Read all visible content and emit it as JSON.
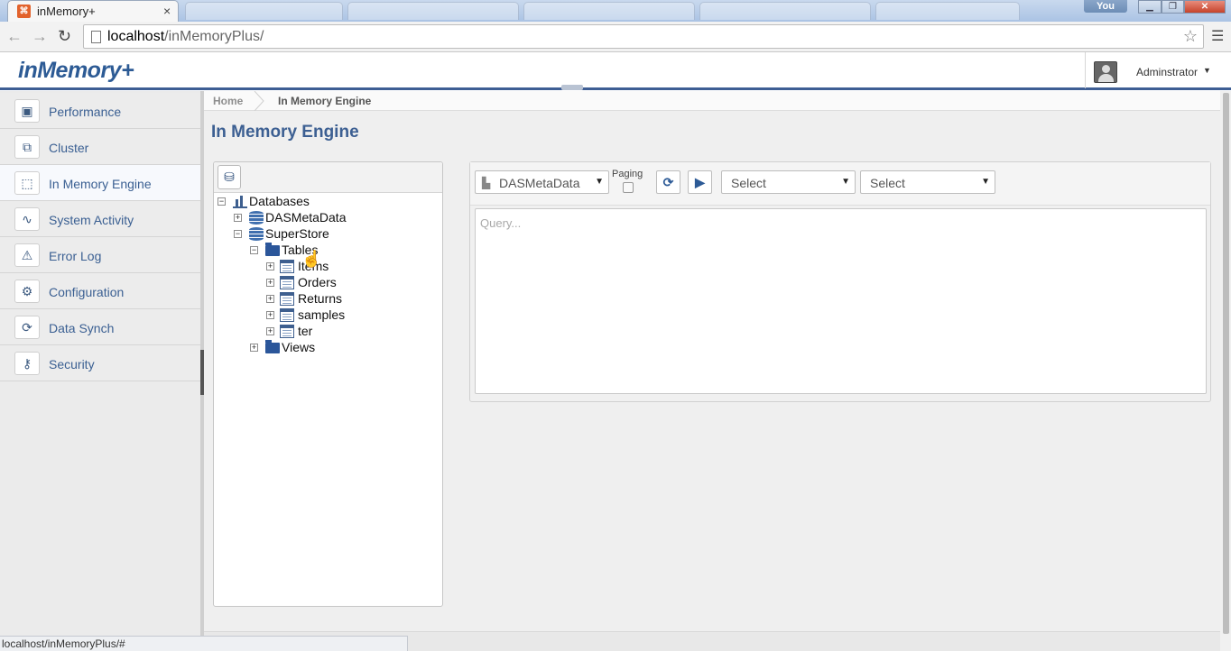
{
  "browser": {
    "tab_title": "inMemory+",
    "tab_close": "×",
    "user_badge": "You",
    "url_host": "localhost",
    "url_path": "/inMemoryPlus/",
    "status_text": "localhost/inMemoryPlus/#"
  },
  "app": {
    "logo": "inMemory+",
    "user_name": "Adminstrator"
  },
  "sidebar": {
    "items": [
      {
        "label": "Performance",
        "icon": "monitor-icon"
      },
      {
        "label": "Cluster",
        "icon": "cluster-icon"
      },
      {
        "label": "In Memory Engine",
        "icon": "chip-icon",
        "active": true
      },
      {
        "label": "System Activity",
        "icon": "activity-icon"
      },
      {
        "label": "Error Log",
        "icon": "warning-icon"
      },
      {
        "label": "Configuration",
        "icon": "gear-icon"
      },
      {
        "label": "Data Synch",
        "icon": "sync-icon"
      },
      {
        "label": "Security",
        "icon": "key-icon"
      }
    ]
  },
  "breadcrumb": {
    "home": "Home",
    "current": "In Memory Engine"
  },
  "page": {
    "title": "In Memory Engine"
  },
  "tree": {
    "root": "Databases",
    "nodes": {
      "db1": "DASMetaData",
      "db2": "SuperStore",
      "tables": "Tables",
      "t1": "Items",
      "t2": "Orders",
      "t3": "Returns",
      "t4": "samples",
      "t5": "ter",
      "views": "Views"
    }
  },
  "query": {
    "database_select": "DASMetaData",
    "paging_label": "Paging",
    "select_1": "Select",
    "select_2": "Select",
    "placeholder": "Query..."
  }
}
